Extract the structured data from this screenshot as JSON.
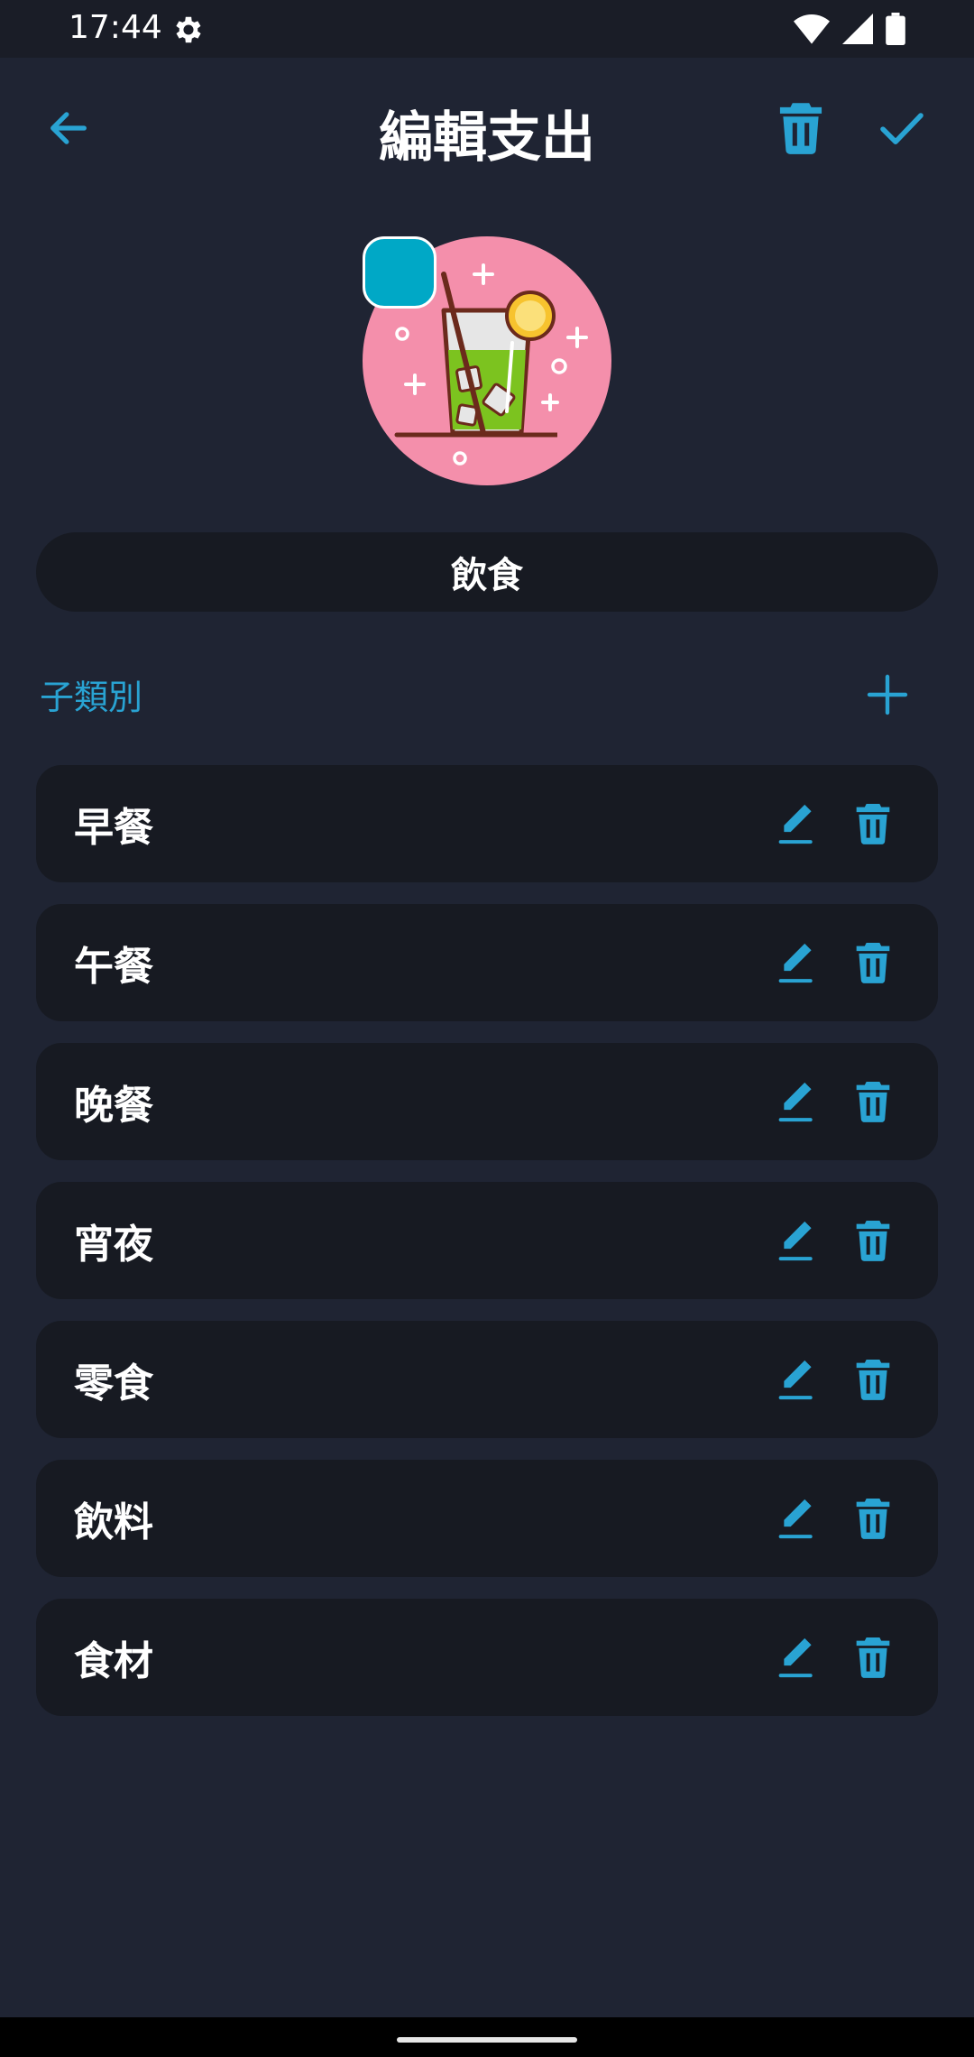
{
  "status_bar": {
    "time": "17:44",
    "icons": [
      "gear-icon",
      "wifi-icon",
      "signal-icon",
      "battery-icon"
    ]
  },
  "app_bar": {
    "title": "編輯支出",
    "back_icon": "arrow-left-icon",
    "delete_icon": "trash-icon",
    "confirm_icon": "check-icon"
  },
  "category": {
    "name": "飲食",
    "icon": "cocktail-drink-icon",
    "swatch_color": "#00a8c6",
    "icon_bg_color": "#f48fab"
  },
  "subcategories": {
    "header": "子類別",
    "add_icon": "plus-icon",
    "items": [
      {
        "label": "早餐"
      },
      {
        "label": "午餐"
      },
      {
        "label": "晚餐"
      },
      {
        "label": "宵夜"
      },
      {
        "label": "零食"
      },
      {
        "label": "飲料"
      },
      {
        "label": "食材"
      }
    ]
  },
  "colors": {
    "accent": "#29a3d3",
    "background": "#1f2433",
    "card": "#171a22"
  }
}
